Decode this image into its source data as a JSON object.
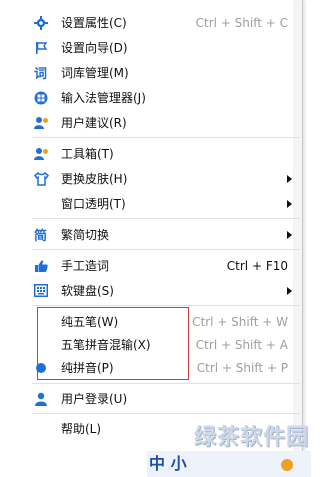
{
  "menu": {
    "items": [
      {
        "label": "设置属性(C)",
        "shortcut": "Ctrl + Shift + C",
        "icon": "gear-icon"
      },
      {
        "label": "设置向导(D)",
        "icon": "flag-icon"
      },
      {
        "label": "词库管理(M)",
        "icon": "dictionary-icon"
      },
      {
        "label": "输入法管理器(J)",
        "icon": "manager-icon"
      },
      {
        "label": "用户建议(R)",
        "icon": "user-feedback-icon"
      },
      {
        "label": "工具箱(T)",
        "icon": "toolbox-icon"
      },
      {
        "label": "更换皮肤(H)",
        "icon": "shirt-icon"
      },
      {
        "label": "窗口透明(T)"
      },
      {
        "label": "繁简切换",
        "icon": "traditional-simplified-icon"
      },
      {
        "label": "手工造词",
        "shortcut": "Ctrl + F10",
        "icon": "hand-icon"
      },
      {
        "label": "软键盘(S)",
        "icon": "keyboard-icon"
      },
      {
        "label": "纯五笔(W)",
        "shortcut": "Ctrl + Shift + W"
      },
      {
        "label": "五笔拼音混输(X)",
        "shortcut": "Ctrl + Shift + A"
      },
      {
        "label": "纯拼音(P)",
        "shortcut": "Ctrl + Shift + P",
        "icon": "selected-dot-icon"
      },
      {
        "label": "用户登录(U)",
        "icon": "person-icon"
      },
      {
        "label": "帮助(L)"
      }
    ]
  },
  "watermark": {
    "title": "绿茶软件园",
    "band_text": "中 小 "
  }
}
